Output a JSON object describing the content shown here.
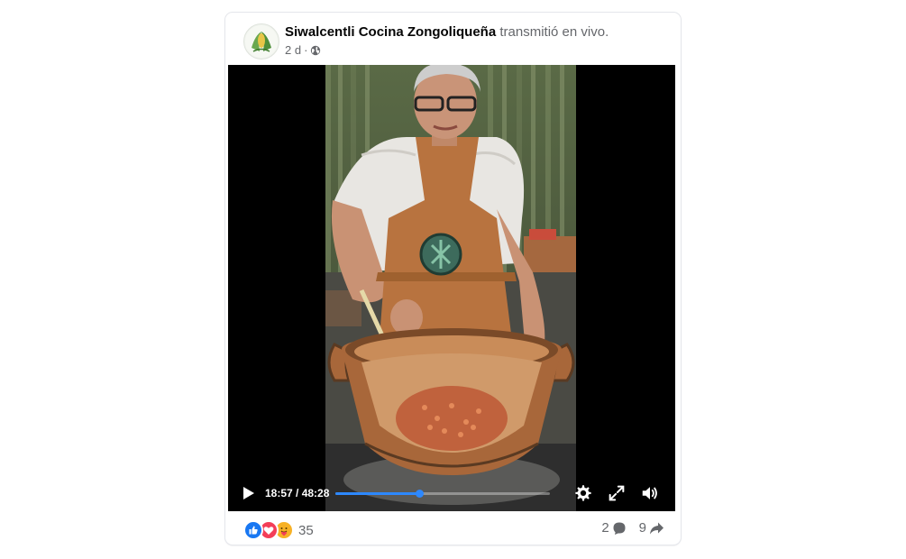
{
  "post": {
    "page_name": "Siwalcentli Cocina Zongoliqueña",
    "action_text": "transmitió en vivo.",
    "time_ago": "2 d",
    "separator": "·",
    "audience_icon": "globe-icon"
  },
  "video": {
    "current_time": "18:57",
    "duration": "48:28",
    "time_display": "18:57 / 48:28",
    "progress_fraction": 0.39,
    "icons": [
      "play-icon",
      "gear-icon",
      "fullscreen-icon",
      "volume-icon"
    ]
  },
  "reactions": {
    "types": [
      "like-icon",
      "love-icon",
      "care-icon"
    ],
    "count": "35"
  },
  "stats": {
    "comments": "2",
    "comment_icon": "comment-icon",
    "shares": "9",
    "share_icon": "share-icon"
  },
  "colors": {
    "accent": "#2d88ff",
    "like": "#1877f2",
    "love": "#f33e58",
    "care": "#f7b125",
    "secondary_text": "#65676b"
  }
}
